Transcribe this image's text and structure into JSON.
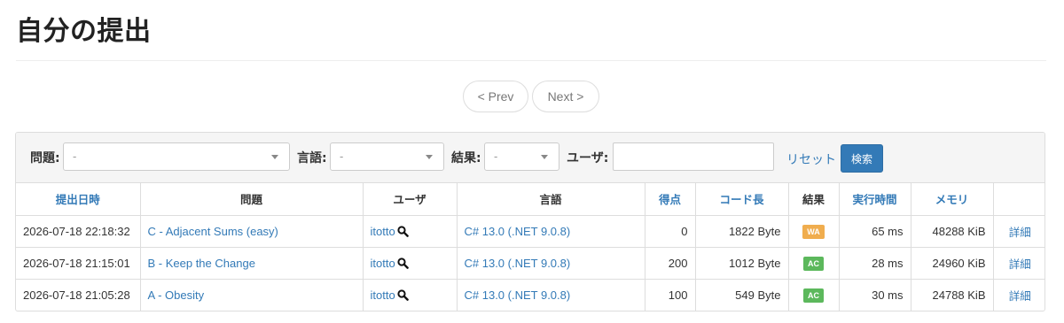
{
  "page": {
    "title": "自分の提出"
  },
  "pager": {
    "prev": "< Prev",
    "next": "Next >"
  },
  "filters": {
    "problem_label": "問題:",
    "problem_value": "-",
    "language_label": "言語:",
    "language_value": "-",
    "status_label": "結果:",
    "status_value": "-",
    "user_label": "ユーザ:",
    "user_value": "",
    "reset": "リセット",
    "search": "検索"
  },
  "table": {
    "headers": {
      "time": "提出日時",
      "problem": "問題",
      "user": "ユーザ",
      "language": "言語",
      "score": "得点",
      "code_length": "コード長",
      "result": "結果",
      "exec_time": "実行時間",
      "memory": "メモリ",
      "detail": ""
    },
    "rows": [
      {
        "time": "2026-07-18 22:18:32",
        "problem": "C - Adjacent Sums (easy)",
        "user": "itotto",
        "language": "C# 13.0 (.NET 9.0.8)",
        "score": "0",
        "code_length": "1822 Byte",
        "result": "WA",
        "result_color": "#f0ad4e",
        "exec_time": "65 ms",
        "memory": "48288 KiB",
        "detail": "詳細"
      },
      {
        "time": "2026-07-18 21:15:01",
        "problem": "B - Keep the Change",
        "user": "itotto",
        "language": "C# 13.0 (.NET 9.0.8)",
        "score": "200",
        "code_length": "1012 Byte",
        "result": "AC",
        "result_color": "#5cb85c",
        "exec_time": "28 ms",
        "memory": "24960 KiB",
        "detail": "詳細"
      },
      {
        "time": "2026-07-18 21:05:28",
        "problem": "A - Obesity",
        "user": "itotto",
        "language": "C# 13.0 (.NET 9.0.8)",
        "score": "100",
        "code_length": "549 Byte",
        "result": "AC",
        "result_color": "#5cb85c",
        "exec_time": "30 ms",
        "memory": "24788 KiB",
        "detail": "詳細"
      }
    ]
  },
  "icons": {
    "user_search": "magnifier-icon",
    "dropdown": "caret-down-icon"
  }
}
